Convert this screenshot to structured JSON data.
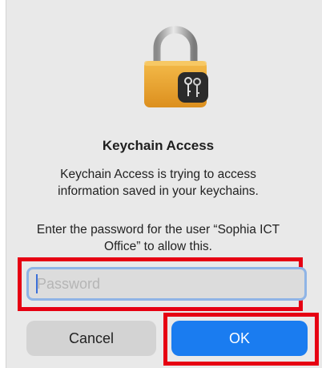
{
  "dialog": {
    "title": "Keychain Access",
    "message": "Keychain Access is trying to access information saved in your keychains.",
    "prompt": "Enter the password for the user “Sophia ICT Office” to allow this.",
    "password": {
      "value": "",
      "placeholder": "Password"
    },
    "cancel_label": "Cancel",
    "ok_label": "OK"
  },
  "icons": {
    "app_icon": "keychain-padlock-icon",
    "badge_icon": "keys-icon"
  },
  "colors": {
    "accent": "#1a7cf0",
    "highlight": "#e60012",
    "dialog_bg": "#e9e9e9"
  }
}
